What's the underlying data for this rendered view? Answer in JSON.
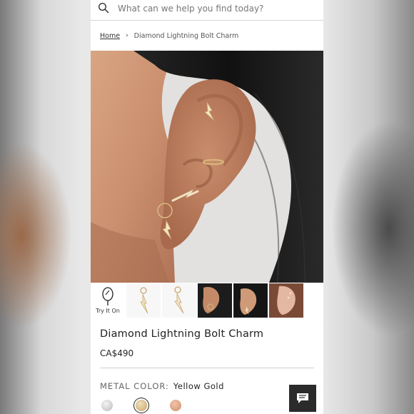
{
  "search": {
    "placeholder": "What can we help you find today?"
  },
  "breadcrumb": {
    "home": "Home",
    "separator": "›",
    "current": "Diamond Lightning Bolt Charm"
  },
  "hero": {
    "image": "ear-piercing-photo"
  },
  "thumbnails": [
    {
      "label": "Try It On",
      "icon": "mirror-icon"
    },
    {
      "image": "charm-front"
    },
    {
      "image": "charm-angle"
    },
    {
      "image": "ear-photo-1"
    },
    {
      "image": "ear-photo-2"
    },
    {
      "image": "ear-photo-3"
    }
  ],
  "product": {
    "title": "Diamond Lightning Bolt Charm",
    "price": "CA$490"
  },
  "metal": {
    "label": "METAL COLOR:",
    "value": "Yellow Gold",
    "options": [
      {
        "name": "silver",
        "color": "#c9c9c9"
      },
      {
        "name": "yellow-gold",
        "color": "#d9be88",
        "selected": true
      },
      {
        "name": "rose-gold",
        "color": "#e0a88a"
      }
    ]
  },
  "chat": {
    "icon": "chat-icon"
  },
  "colors": {
    "accent": "#2b2b2b",
    "divider": "#cfcfcf"
  }
}
